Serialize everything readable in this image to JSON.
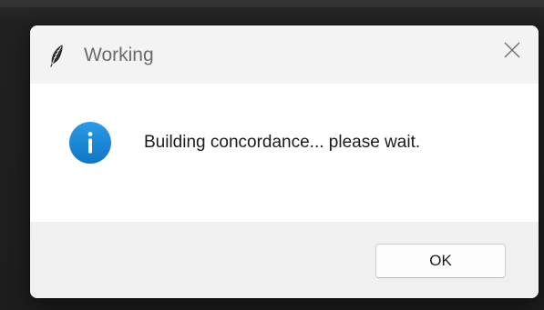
{
  "dialog": {
    "title": "Working",
    "app_icon": "feather-icon",
    "close_icon": "close-icon",
    "message_icon": "info-icon",
    "message": "Building concordance... please wait.",
    "ok_label": "OK"
  },
  "colors": {
    "info_blue": "#1a8ad4",
    "titlebar_bg": "#f3f3f3",
    "footer_bg": "#f0f0f0",
    "backdrop": "#1d1d1d"
  }
}
